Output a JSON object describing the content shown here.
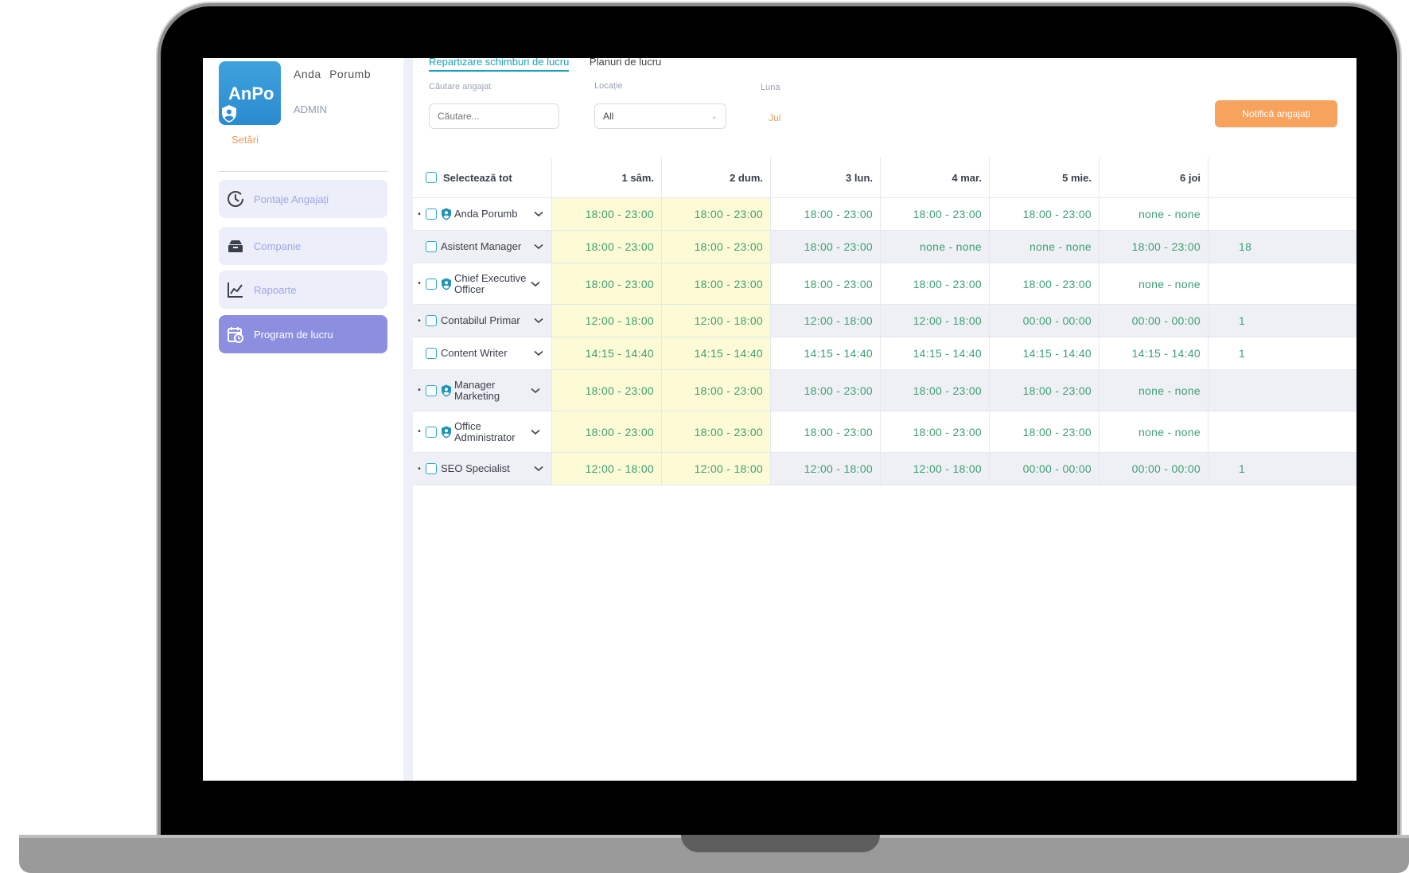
{
  "sidebar": {
    "logo_text": "AnPo",
    "user_name": "Anda Porumb",
    "user_role": "ADMIN",
    "settings_label": "Setări",
    "items": [
      {
        "label": "Pontaje Angajați",
        "icon": "clock-icon"
      },
      {
        "label": "Companie",
        "icon": "company-icon"
      },
      {
        "label": "Rapoarte",
        "icon": "chart-icon"
      },
      {
        "label": "Program de lucru",
        "icon": "calendar-icon",
        "active": true
      }
    ]
  },
  "tabs": [
    {
      "label": "Repartizare schimburi de lucru",
      "active": true
    },
    {
      "label": "Planuri de lucru",
      "active": false
    }
  ],
  "filters": {
    "search_label": "Căutare angajat",
    "search_placeholder": "Căutare...",
    "location_label": "Locație",
    "location_value": "All",
    "month_label": "Luna",
    "month_value": "Jul"
  },
  "notify_button": "Notifică angajați",
  "table": {
    "select_all_label": "Selectează tot",
    "days": [
      "1 sâm.",
      "2 dum.",
      "3 lun.",
      "4 mar.",
      "5 mie.",
      "6 joi"
    ],
    "rows": [
      {
        "name": "Anda Porumb",
        "admin": true,
        "bullet": true,
        "shifts": [
          "18:00 - 23:00",
          "18:00 - 23:00",
          "18:00 - 23:00",
          "18:00 - 23:00",
          "18:00 - 23:00",
          "none - none"
        ],
        "next_partial": ""
      },
      {
        "name": "Asistent Manager",
        "admin": false,
        "bullet": false,
        "shifts": [
          "18:00 - 23:00",
          "18:00 - 23:00",
          "18:00 - 23:00",
          "none - none",
          "none - none",
          "18:00 - 23:00"
        ],
        "next_partial": "18"
      },
      {
        "name": "Chief Executive Officer",
        "admin": true,
        "bullet": true,
        "shifts": [
          "18:00 - 23:00",
          "18:00 - 23:00",
          "18:00 - 23:00",
          "18:00 - 23:00",
          "18:00 - 23:00",
          "none - none"
        ],
        "next_partial": ""
      },
      {
        "name": "Contabilul Primar",
        "admin": false,
        "bullet": true,
        "shifts": [
          "12:00 - 18:00",
          "12:00 - 18:00",
          "12:00 - 18:00",
          "12:00 - 18:00",
          "00:00 - 00:00",
          "00:00 - 00:00"
        ],
        "next_partial": "1"
      },
      {
        "name": "Content Writer",
        "admin": false,
        "bullet": false,
        "shifts": [
          "14:15 - 14:40",
          "14:15 - 14:40",
          "14:15 - 14:40",
          "14:15 - 14:40",
          "14:15 - 14:40",
          "14:15 - 14:40"
        ],
        "next_partial": "1"
      },
      {
        "name": "Manager Marketing",
        "admin": true,
        "bullet": true,
        "shifts": [
          "18:00 - 23:00",
          "18:00 - 23:00",
          "18:00 - 23:00",
          "18:00 - 23:00",
          "18:00 - 23:00",
          "none - none"
        ],
        "next_partial": ""
      },
      {
        "name": "Office Administrator",
        "admin": true,
        "bullet": true,
        "shifts": [
          "18:00 - 23:00",
          "18:00 - 23:00",
          "18:00 - 23:00",
          "18:00 - 23:00",
          "18:00 - 23:00",
          "none - none"
        ],
        "next_partial": ""
      },
      {
        "name": "SEO Specialist",
        "admin": false,
        "bullet": true,
        "shifts": [
          "12:00 - 18:00",
          "12:00 - 18:00",
          "12:00 - 18:00",
          "12:00 - 18:00",
          "00:00 - 00:00",
          "00:00 - 00:00"
        ],
        "next_partial": "1"
      }
    ]
  },
  "colors": {
    "accent": "#1aa0b8",
    "nav_active": "#8c8fe0",
    "notify": "#f7a25d",
    "shift_text": "#3d9f72",
    "weekend_bg": "#fdfbd6"
  }
}
